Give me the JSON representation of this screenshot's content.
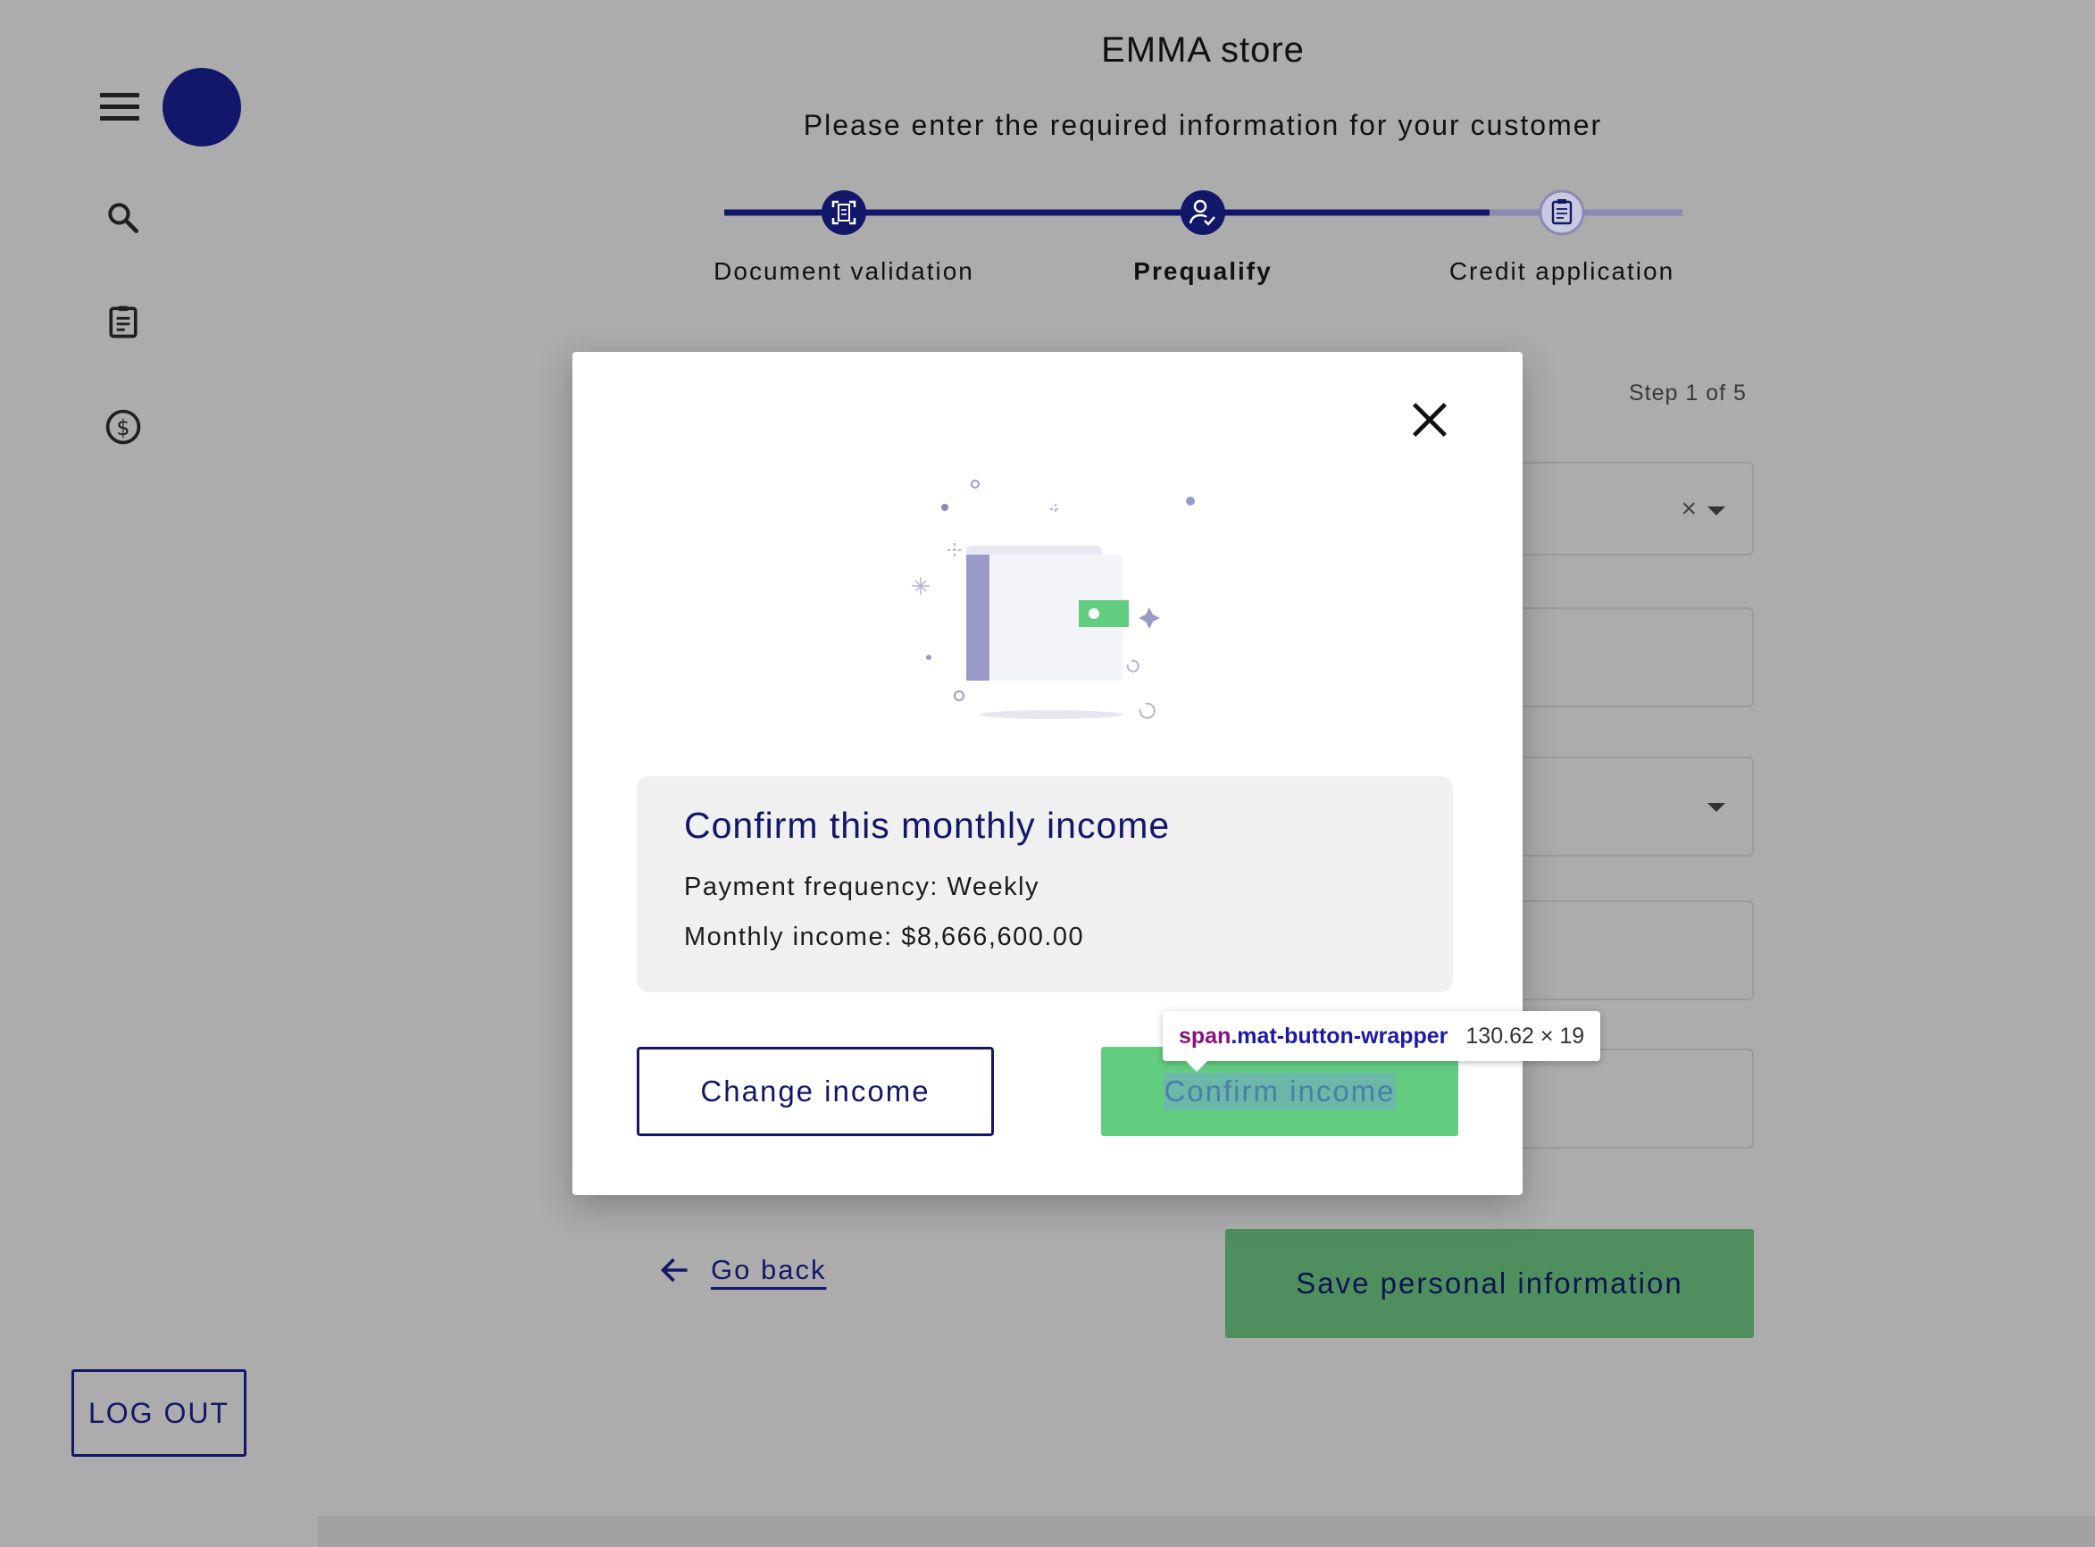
{
  "app": {
    "store_title": "EMMA store",
    "subtitle": "Please enter the required information for your customer"
  },
  "sidebar": {
    "icons": [
      "menu-icon",
      "search-icon",
      "clipboard-icon",
      "dollar-icon"
    ],
    "logout_label": "LOG OUT",
    "avatar_color": "#12176a"
  },
  "stepper": {
    "steps": [
      {
        "label": "Document validation",
        "icon": "document-scan-icon",
        "status": "complete"
      },
      {
        "label": "Prequalify",
        "icon": "person-check-icon",
        "status": "active"
      },
      {
        "label": "Credit application",
        "icon": "clipboard-icon",
        "status": "pending"
      }
    ],
    "step_count": "Step 1 of 5"
  },
  "form": {
    "go_back_label": "Go back",
    "save_label": "Save personal information"
  },
  "modal": {
    "illustration": "wallet-icon",
    "title": "Confirm this monthly income",
    "payment_frequency": "Payment frequency: Weekly",
    "monthly_income": "Monthly income: $8,666,600.00",
    "change_label": "Change income",
    "confirm_label": "Confirm income"
  },
  "devtools_tooltip": {
    "tag": "span",
    "class_name": ".mat-button-wrapper",
    "size": "130.62 × 19"
  },
  "colors": {
    "primary": "#12176a",
    "success": "#62cc7f",
    "overlay": "#acacac"
  }
}
